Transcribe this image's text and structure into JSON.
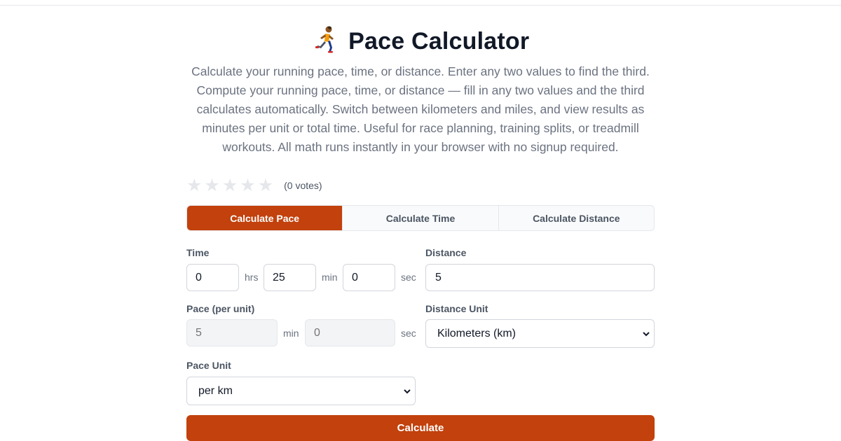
{
  "page": {
    "title": "Pace Calculator",
    "description": "Calculate your running pace, time, or distance. Enter any two values to find the third. Compute your running pace, time, or distance — fill in any two values and the third calculates automatically. Switch between kilometers and miles, and view results as minutes per unit or total time. Useful for race planning, training splits, or treadmill workouts. All math runs instantly in your browser with no signup required."
  },
  "rating": {
    "stars": 5,
    "filled": 0,
    "votes_label": "(0 votes)"
  },
  "tabs": [
    {
      "label": "Calculate Pace",
      "active": true
    },
    {
      "label": "Calculate Time",
      "active": false
    },
    {
      "label": "Calculate Distance",
      "active": false
    }
  ],
  "time": {
    "label": "Time",
    "hours": "0",
    "hours_unit": "hrs",
    "minutes": "25",
    "minutes_unit": "min",
    "seconds": "0",
    "seconds_unit": "sec"
  },
  "distance": {
    "label": "Distance",
    "value": "5"
  },
  "pace": {
    "label": "Pace (per unit)",
    "minutes_placeholder": "5",
    "minutes_unit": "min",
    "seconds_placeholder": "0",
    "seconds_unit": "sec"
  },
  "distance_unit": {
    "label": "Distance Unit",
    "selected": "Kilometers (km)"
  },
  "pace_unit": {
    "label": "Pace Unit",
    "selected": "per km"
  },
  "actions": {
    "calculate_label": "Calculate"
  },
  "colors": {
    "accent": "#c2410c",
    "muted_text": "#6b7280",
    "border": "#d1d5db"
  }
}
